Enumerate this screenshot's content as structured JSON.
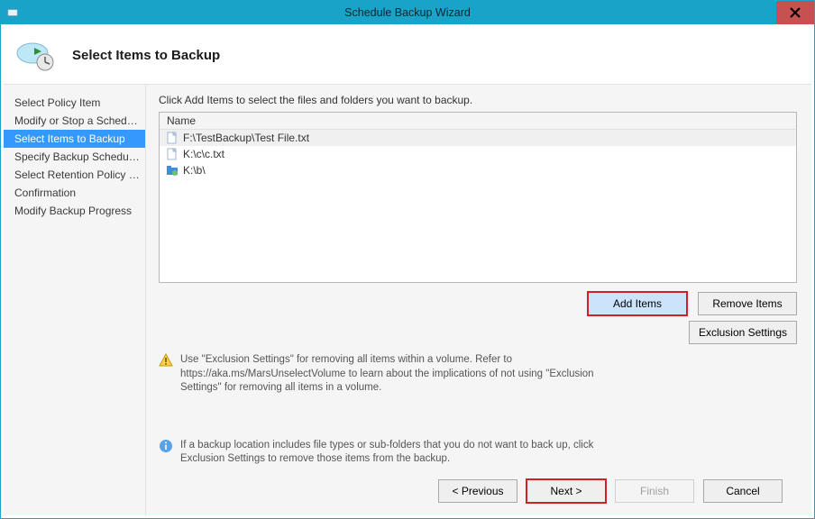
{
  "titlebar": {
    "title": "Schedule Backup Wizard"
  },
  "header": {
    "heading": "Select Items to Backup"
  },
  "sidebar": {
    "items": [
      {
        "label": "Select Policy Item",
        "active": false
      },
      {
        "label": "Modify or Stop a Schedul...",
        "active": false
      },
      {
        "label": "Select Items to Backup",
        "active": true
      },
      {
        "label": "Specify Backup Schedule ...",
        "active": false
      },
      {
        "label": "Select Retention Policy (F...",
        "active": false
      },
      {
        "label": "Confirmation",
        "active": false
      },
      {
        "label": "Modify Backup Progress",
        "active": false
      }
    ]
  },
  "main": {
    "intro": "Click Add Items to select the files and folders you want to backup.",
    "list": {
      "column_header": "Name",
      "items": [
        {
          "text": "F:\\TestBackup\\Test File.txt",
          "icon": "file",
          "selected": true
        },
        {
          "text": "K:\\c\\c.txt",
          "icon": "file",
          "selected": false
        },
        {
          "text": "K:\\b\\",
          "icon": "folder-special",
          "selected": false
        }
      ]
    },
    "buttons": {
      "add": "Add Items",
      "remove": "Remove Items",
      "exclusion": "Exclusion Settings"
    },
    "warning_text": "Use \"Exclusion Settings\" for removing all items within a volume. Refer to https://aka.ms/MarsUnselectVolume to learn about the implications of not using \"Exclusion Settings\" for removing all items in a volume.",
    "info_text": "If a backup location includes file types or sub-folders that you do not want to back up, click Exclusion Settings to remove those items from the backup."
  },
  "footer": {
    "previous": "< Previous",
    "next": "Next >",
    "finish": "Finish",
    "cancel": "Cancel"
  },
  "colors": {
    "accent": "#1aa3c8",
    "selection": "#3399ff",
    "highlight_red": "#d22024",
    "close_red": "#c75050"
  }
}
